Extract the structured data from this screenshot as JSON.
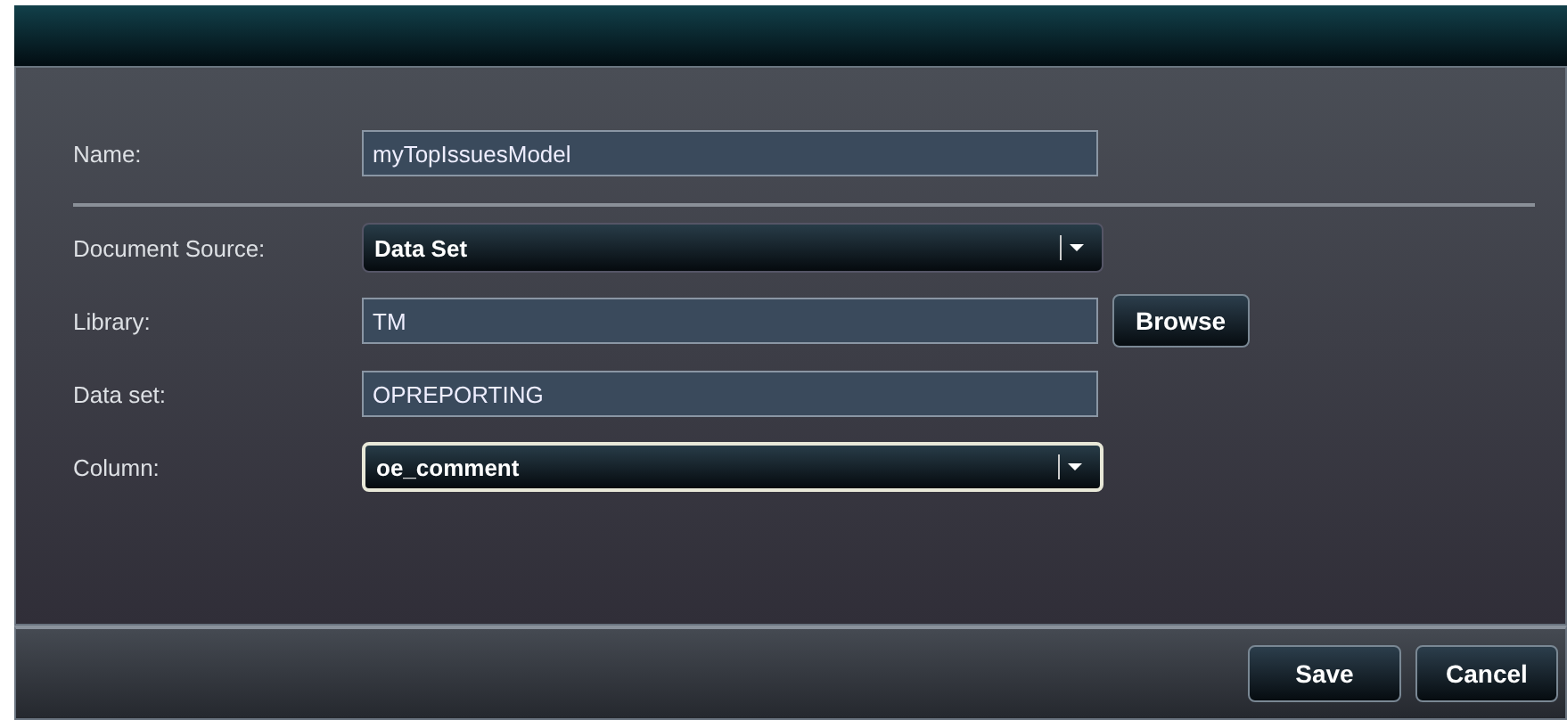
{
  "name_field": {
    "label": "Name:",
    "value": "myTopIssuesModel"
  },
  "fields": [
    {
      "kind": "select",
      "label": "Document Source:",
      "value": "Data Set",
      "focused": false
    },
    {
      "kind": "text",
      "label": "Library:",
      "value": "TM",
      "button": "Browse"
    },
    {
      "kind": "text",
      "label": "Data set:",
      "value": "OPREPORTING"
    },
    {
      "kind": "select",
      "label": "Column:",
      "value": "oe_comment",
      "focused": true
    }
  ],
  "buttons": [
    "Save",
    "Cancel"
  ]
}
